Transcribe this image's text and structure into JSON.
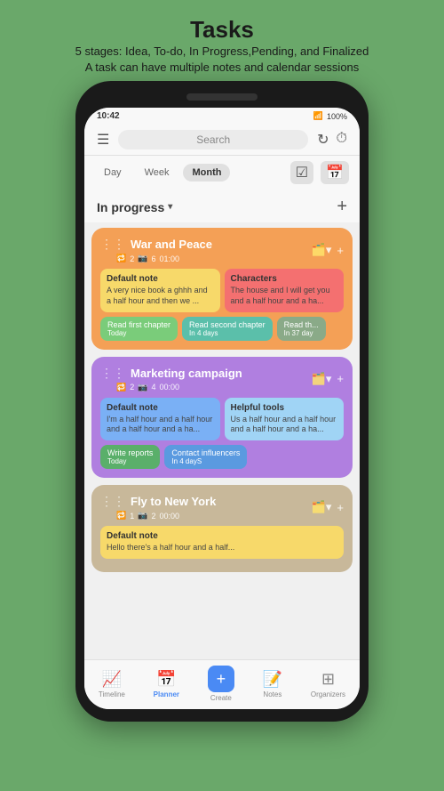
{
  "header": {
    "title": "Tasks",
    "subtitle_line1": "5 stages: Idea, To-do, In Progress,Pending, and Finalized",
    "subtitle_line2": "A task can have multiple notes and calendar sessions"
  },
  "status_bar": {
    "time": "10:42",
    "battery": "100%"
  },
  "top_bar": {
    "search_placeholder": "Search",
    "refresh_icon": "↻",
    "timer_icon": "⏱"
  },
  "filter_tabs": {
    "tabs": [
      "Day",
      "Week",
      "Month"
    ],
    "active": "Month"
  },
  "section": {
    "title": "In progress",
    "add_label": "+"
  },
  "task_cards": [
    {
      "id": "war-and-peace",
      "title": "War and Peace",
      "meta": "2  6  01:00",
      "color": "orange",
      "notes": [
        {
          "title": "Default note",
          "text": "A very nice book a ghhh and a half hour and then we ...",
          "color": "yellow"
        },
        {
          "title": "Characters",
          "text": "The house and I will get you and a half hour and a ha...",
          "color": "red"
        }
      ],
      "sessions": [
        {
          "label": "Read first chapter",
          "date": "Today",
          "color": "light-green"
        },
        {
          "label": "Read second chapter",
          "date": "In 4 days",
          "color": "teal"
        },
        {
          "label": "Read th...",
          "date": "In 37 day",
          "color": "gray-green"
        }
      ]
    },
    {
      "id": "marketing-campaign",
      "title": "Marketing campaign",
      "meta": "2  4  00:00",
      "color": "purple",
      "notes": [
        {
          "title": "Default note",
          "text": "I'm a half hour and a half hour and a half hour and a ha...",
          "color": "blue"
        },
        {
          "title": "Helpful tools",
          "text": "Us a half hour and a half hour and a half hour and a ha...",
          "color": "light-blue"
        }
      ],
      "sessions": [
        {
          "label": "Write reports",
          "date": "Today",
          "color": "green-btn"
        },
        {
          "label": "Contact influencers",
          "date": "In 4 dayS",
          "color": "purple-btn"
        }
      ]
    },
    {
      "id": "fly-to-new-york",
      "title": "Fly to New York",
      "meta": "1  2  00:00",
      "color": "tan",
      "notes": [
        {
          "title": "Default note",
          "text": "Hello there's a half hour and a half...",
          "color": "yellow"
        }
      ],
      "sessions": []
    }
  ],
  "bottom_nav": {
    "items": [
      {
        "id": "timeline",
        "label": "Timeline",
        "icon": "📈",
        "active": false
      },
      {
        "id": "planner",
        "label": "Planner",
        "icon": "📅",
        "active": true
      },
      {
        "id": "create",
        "label": "Create",
        "icon": "+",
        "active": false
      },
      {
        "id": "notes",
        "label": "Notes",
        "icon": "📝",
        "active": false
      },
      {
        "id": "organizers",
        "label": "Organizers",
        "icon": "⊞",
        "active": false
      }
    ]
  }
}
